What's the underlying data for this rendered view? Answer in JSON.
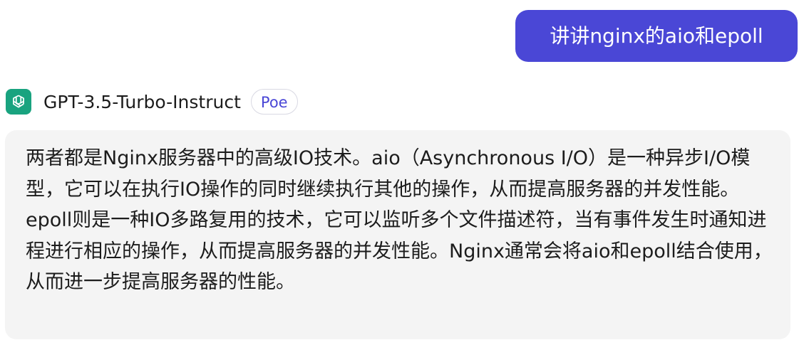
{
  "user_message": {
    "text": "讲讲nginx的aio和epoll"
  },
  "bot": {
    "icon": "openai-logo-icon",
    "name": "GPT-3.5-Turbo-Instruct",
    "badge": "Poe",
    "message": "两者都是Nginx服务器中的高级IO技术。aio（Asynchronous I/O）是一种异步I/O模型，它可以在执行IO操作的同时继续执行其他的操作，从而提高服务器的并发性能。epoll则是一种IO多路复用的技术，它可以监听多个文件描述符，当有事件发生时通知进程进行相应的操作，从而提高服务器的并发性能。Nginx通常会将aio和epoll结合使用，从而进一步提高服务器的性能。"
  },
  "colors": {
    "user_bubble": "#4a47d6",
    "bot_bubble": "#f4f4f4",
    "bot_avatar": "#19a37f",
    "badge_text": "#4a47d6"
  }
}
